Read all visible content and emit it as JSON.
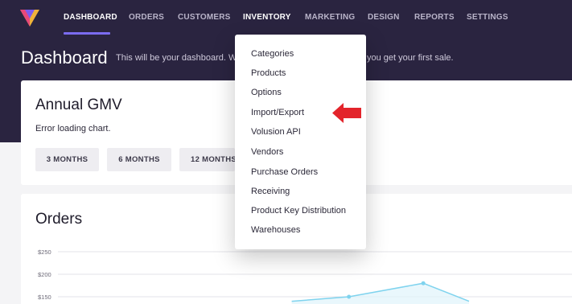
{
  "nav": {
    "items": [
      {
        "label": "DASHBOARD",
        "active": true
      },
      {
        "label": "ORDERS"
      },
      {
        "label": "CUSTOMERS"
      },
      {
        "label": "INVENTORY"
      },
      {
        "label": "MARKETING"
      },
      {
        "label": "DESIGN"
      },
      {
        "label": "REPORTS"
      },
      {
        "label": "SETTINGS"
      }
    ]
  },
  "page": {
    "title": "Dashboard",
    "subtitle_left": "This will be your dashboard. W",
    "subtitle_right": "you get your first sale."
  },
  "gmv_card": {
    "title": "Annual GMV",
    "error": "Error loading chart.",
    "ranges": [
      "3 MONTHS",
      "6 MONTHS",
      "12 MONTHS"
    ]
  },
  "orders_card": {
    "title": "Orders"
  },
  "inventory_menu": {
    "items": [
      "Categories",
      "Products",
      "Options",
      "Import/Export",
      "Volusion API",
      "Vendors",
      "Purchase Orders",
      "Receiving",
      "Product Key Distribution",
      "Warehouses"
    ]
  },
  "colors": {
    "header": "#2a2440",
    "accent": "#7b6cf0",
    "arrow": "#e3242b",
    "chart_line": "#7fd3ee"
  },
  "chart_data": {
    "type": "line",
    "title": "Orders",
    "y_ticks": [
      "$250",
      "$200",
      "$150"
    ],
    "ylim": [
      150,
      250
    ],
    "points": [
      {
        "x": 0.51,
        "y": 140
      },
      {
        "x": 0.61,
        "y": 150
      },
      {
        "x": 0.74,
        "y": 180
      },
      {
        "x": 0.82,
        "y": 140
      }
    ],
    "grid": true
  }
}
